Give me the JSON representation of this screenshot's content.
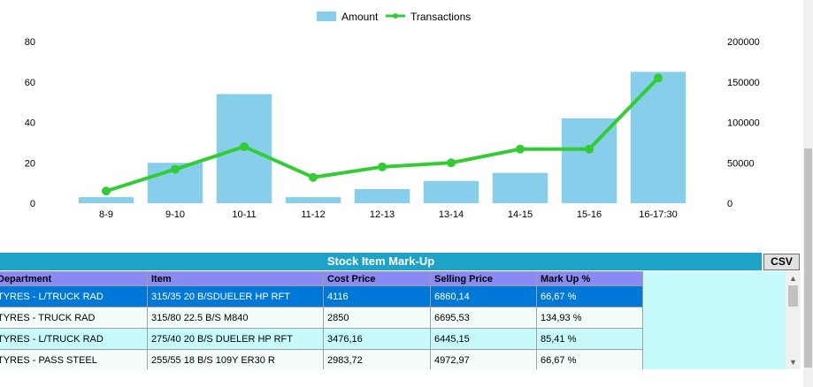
{
  "chart_data": {
    "type": "bar",
    "categories": [
      "8-9",
      "9-10",
      "10-11",
      "11-12",
      "12-13",
      "13-14",
      "14-15",
      "15-16",
      "16-17:30"
    ],
    "series": [
      {
        "name": "Amount",
        "type": "bar",
        "axis": "left",
        "color": "#87ceeb",
        "values": [
          3,
          20,
          54,
          3,
          7,
          11,
          15,
          42,
          65
        ]
      },
      {
        "name": "Transactions",
        "type": "line",
        "axis": "right",
        "color": "#32cd32",
        "values": [
          15000,
          42000,
          70000,
          32000,
          45000,
          50000,
          67000,
          67000,
          155000
        ]
      }
    ],
    "y_left_ticks": [
      0,
      20,
      40,
      60,
      80
    ],
    "y_right_ticks": [
      0,
      50000,
      100000,
      150000,
      200000
    ],
    "ylim_left": [
      0,
      80
    ],
    "ylim_right": [
      0,
      200000
    ],
    "legend_position": "top-center"
  },
  "grid": {
    "title": "Stock Item Mark-Up",
    "csv_label": "CSV",
    "columns": [
      "Department",
      "Item",
      "Cost Price",
      "Selling Price",
      "Mark Up %"
    ],
    "rows": [
      [
        "TYRES - L/TRUCK RAD",
        "315/35 20 B/SDUELER HP RFT",
        "4116",
        "6860,14",
        "66,67 %"
      ],
      [
        "TYRES - TRUCK RAD",
        "315/80 22.5 B/S M840",
        "2850",
        "6695,53",
        "134,93 %"
      ],
      [
        "TYRES - L/TRUCK RAD",
        "275/40 20 B/S DUELER HP RFT",
        "3476,16",
        "6445,15",
        "85,41 %"
      ],
      [
        "TYRES - PASS STEEL",
        "255/55 18 B/S 109Y ER30 R",
        "2983,72",
        "4972,97",
        "66,67 %"
      ]
    ]
  },
  "icons": {
    "scroll_up": "▲",
    "scroll_down": "▼"
  }
}
